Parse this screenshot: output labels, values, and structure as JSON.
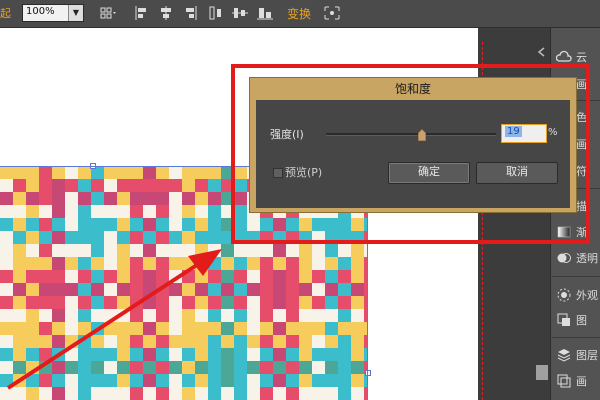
{
  "toolbar": {
    "left_fragment": "起",
    "zoom": "100%",
    "icons": [
      "align-left-icon",
      "align-center-icon",
      "align-right-icon",
      "distribute-icon",
      "distribute-vertical-icon",
      "align-bottom-icon",
      "expand-icon"
    ],
    "transform_label": "变换"
  },
  "dialog": {
    "title": "饱和度",
    "strength_label": "强度(I)",
    "strength_value": "19",
    "percent": "%",
    "preview_label": "预览(P)",
    "ok_label": "确定",
    "cancel_label": "取消",
    "slider_value_percent": 19
  },
  "panel": {
    "items": [
      {
        "icon": "cloud-icon",
        "label": "云"
      },
      {
        "icon": "brush-icon",
        "label": "画"
      },
      {
        "icon": "color-icon",
        "label": "色"
      },
      {
        "icon": "swatch-icon",
        "label": "画"
      },
      {
        "icon": "symbol-icon",
        "label": "符"
      },
      {
        "icon": "stroke-icon",
        "label": "描"
      },
      {
        "icon": "gradient-icon",
        "label": "渐"
      },
      {
        "icon": "transparency-icon",
        "label": "透明"
      },
      {
        "icon": "appearance-icon",
        "label": "外观"
      },
      {
        "icon": "graphic-style-icon",
        "label": "图"
      },
      {
        "icon": "layers-icon",
        "label": "图层"
      },
      {
        "icon": "artboard-icon",
        "label": "画"
      }
    ]
  },
  "colors": {
    "accent": "#e8a020",
    "annotation_red": "#e21b1b",
    "dialog_frame": "#c9a563",
    "pattern": [
      "#e23a5a",
      "#f5c84b",
      "#27b6c7",
      "#f7f2e6",
      "#3a9d8c",
      "#c23466"
    ]
  }
}
